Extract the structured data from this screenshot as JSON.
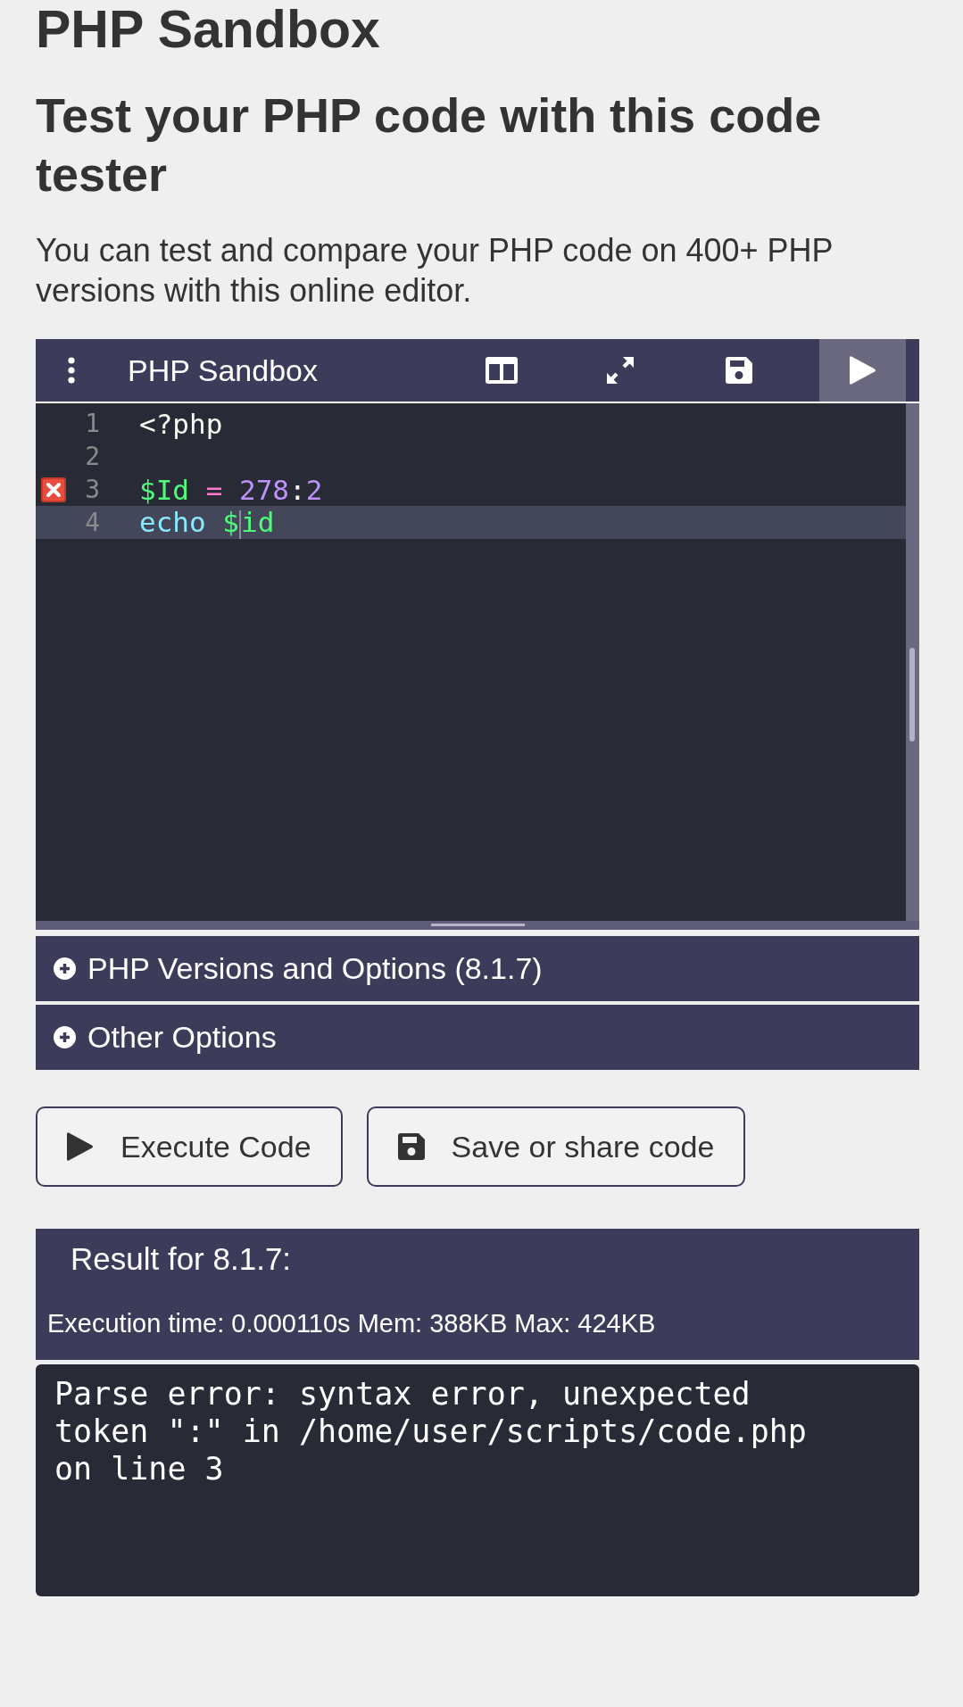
{
  "page_title": "PHP Sandbox",
  "subtitle": "Test your PHP code with this code tester",
  "intro": "You can test and compare your PHP code on 400+ PHP versions with this online editor.",
  "editor": {
    "title": "PHP Sandbox",
    "toolbar": [
      {
        "kind": "split"
      },
      {
        "kind": "fullscreen"
      },
      {
        "kind": "save"
      },
      {
        "kind": "run"
      }
    ],
    "lines": [
      {
        "number": "1",
        "error": false,
        "active": false,
        "tokens": [
          {
            "text": "<?php",
            "kind": "plain"
          }
        ]
      },
      {
        "number": "2",
        "error": false,
        "active": false
      },
      {
        "number": "3",
        "error": true,
        "active": false,
        "tokens": [
          {
            "text": "$Id",
            "kind": "variable"
          },
          {
            "text": "=",
            "kind": "operator",
            "spaced": true
          },
          {
            "text": "278",
            "kind": "number",
            "spaced": true
          },
          {
            "text": ":",
            "kind": "plain"
          },
          {
            "text": "2",
            "kind": "number"
          }
        ]
      },
      {
        "number": "4",
        "error": false,
        "active": true,
        "tokens": [
          {
            "text": "echo",
            "kind": "keyword"
          },
          {
            "text": "$",
            "kind": "variable",
            "spaced": true,
            "cursor": true
          },
          {
            "text": "id",
            "kind": "variable"
          }
        ]
      }
    ]
  },
  "panels": [
    {
      "label": "PHP Versions and Options (8.1.7)",
      "expanded": false
    },
    {
      "label": "Other Options",
      "expanded": false
    }
  ],
  "buttons": [
    {
      "label": "Execute Code",
      "kind": "run"
    },
    {
      "label": "Save or share code",
      "kind": "save"
    }
  ],
  "result": {
    "title": "Result for 8.1.7:",
    "stats": "Execution time: 0.000110s Mem: 388KB Max: 424KB",
    "output": "Parse error: syntax error, unexpected token \":\" in /home/user/scripts/code.php on line 3"
  }
}
